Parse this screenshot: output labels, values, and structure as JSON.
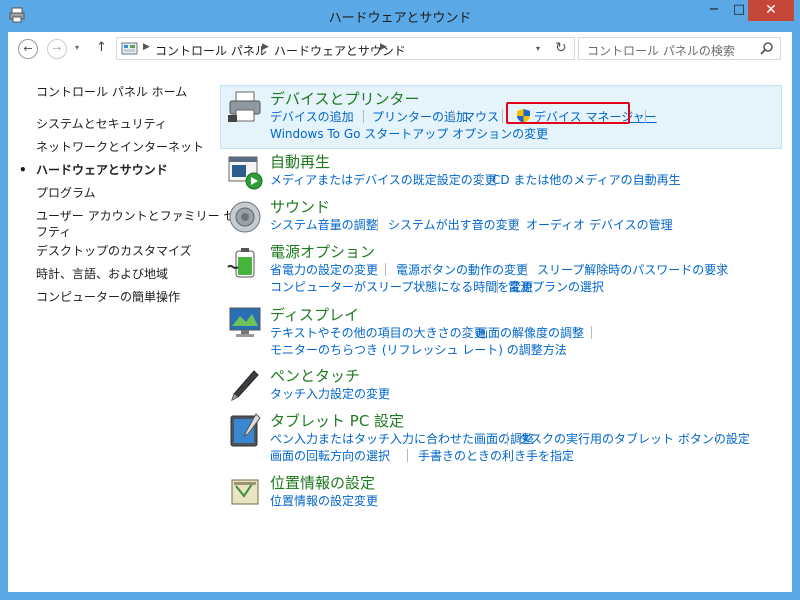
{
  "window": {
    "title": "ハードウェアとサウンド",
    "minimize": "−",
    "maximize": "□",
    "close": "✕"
  },
  "nav": {
    "back": "←",
    "forward": "→",
    "up": "↑",
    "dropdown": "▾",
    "refresh": "↻",
    "breadcrumb": [
      "コントロール パネル",
      "ハードウェアとサウンド"
    ]
  },
  "search": {
    "placeholder": "コントロール パネルの検索"
  },
  "sidebar": {
    "items": [
      {
        "label": "コントロール パネル ホーム"
      },
      {
        "label": "システムとセキュリティ"
      },
      {
        "label": "ネットワークとインターネット"
      },
      {
        "label": "ハードウェアとサウンド",
        "current": true
      },
      {
        "label": "プログラム"
      },
      {
        "label": "ユーザー アカウントとファミリー セー"
      },
      {
        "label": "フティ"
      },
      {
        "label": "デスクトップのカスタマイズ"
      },
      {
        "label": "時計、言語、および地域"
      },
      {
        "label": "コンピューターの簡単操作"
      }
    ],
    "bullet": "•"
  },
  "categories": [
    {
      "title": "デバイスとプリンター",
      "icon": "printer-icon",
      "links": [
        "デバイスの追加",
        "プリンターの追加",
        "マウス",
        "デバイス マネージャー",
        "Windows To Go スタートアップ オプションの変更"
      ]
    },
    {
      "title": "自動再生",
      "icon": "autoplay-icon",
      "links": [
        "メディアまたはデバイスの既定設定の変更",
        "CD または他のメディアの自動再生"
      ]
    },
    {
      "title": "サウンド",
      "icon": "speaker-icon",
      "links": [
        "システム音量の調整",
        "システムが出す音の変更",
        "オーディオ デバイスの管理"
      ]
    },
    {
      "title": "電源オプション",
      "icon": "battery-icon",
      "links": [
        "省電力の設定の変更",
        "電源ボタンの動作の変更",
        "スリープ解除時のパスワードの要求",
        "コンピューターがスリープ状態になる時間を変更",
        "電源プランの選択"
      ]
    },
    {
      "title": "ディスプレイ",
      "icon": "monitor-icon",
      "links": [
        "テキストやその他の項目の大きさの変更",
        "画面の解像度の調整",
        "モニターのちらつき (リフレッシュ レート) の調整方法"
      ]
    },
    {
      "title": "ペンとタッチ",
      "icon": "pen-icon",
      "links": [
        "タッチ入力設定の変更"
      ]
    },
    {
      "title": "タブレット PC 設定",
      "icon": "tablet-icon",
      "links": [
        "ペン入力またはタッチ入力に合わせた画面の調整",
        "タスクの実行用のタブレット ボタンの設定",
        "画面の回転方向の選択",
        "手書きのときの利き手を指定"
      ]
    },
    {
      "title": "位置情報の設定",
      "icon": "location-icon",
      "links": [
        "位置情報の設定変更"
      ]
    }
  ],
  "colors": {
    "title_bar": "#5aa8e6",
    "close_button": "#c7463a",
    "category_title": "#1e7a1e",
    "link": "#0066cc",
    "highlight_border": "#e3001b"
  }
}
